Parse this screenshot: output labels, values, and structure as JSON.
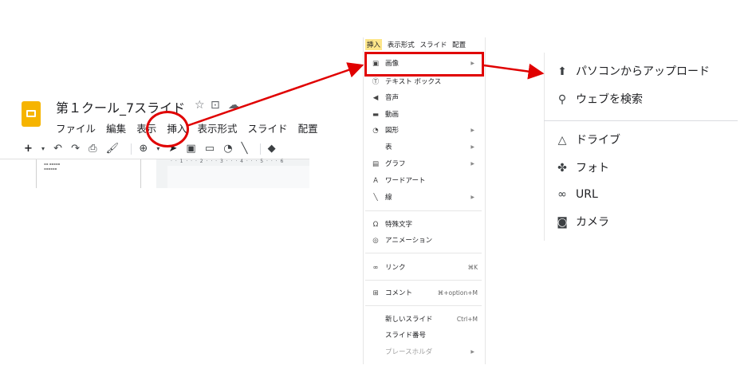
{
  "slides": {
    "doc_title": "第１クール_7スライド",
    "menu": [
      "ファイル",
      "編集",
      "表示",
      "挿入",
      "表示形式",
      "スライド",
      "配置"
    ],
    "ruler_text": "· · 1 · · · 2 · · · 3 · · · 4 · · · 5 · · · 6"
  },
  "insert_menu": {
    "header": [
      "挿入",
      "表示形式",
      "スライド",
      "配置"
    ],
    "items": [
      {
        "label": "画像",
        "icon": "image-icon",
        "arrow": true
      },
      {
        "label": "テキスト ボックス",
        "icon": "textbox-icon"
      },
      {
        "label": "音声",
        "icon": "audio-icon"
      },
      {
        "label": "動画",
        "icon": "video-icon"
      },
      {
        "label": "図形",
        "icon": "shape-icon",
        "arrow": true
      },
      {
        "label": "表",
        "icon": "",
        "arrow": true
      },
      {
        "label": "グラフ",
        "icon": "chart-icon",
        "arrow": true
      },
      {
        "label": "ワードアート",
        "icon": "wordart-icon"
      },
      {
        "label": "線",
        "icon": "line-icon",
        "arrow": true
      },
      {
        "label": "特殊文字",
        "icon": "omega-icon"
      },
      {
        "label": "アニメーション",
        "icon": "animation-icon"
      },
      {
        "label": "リンク",
        "icon": "link-icon",
        "shortcut": "⌘K"
      },
      {
        "label": "コメント",
        "icon": "comment-icon",
        "shortcut": "⌘+option+M"
      },
      {
        "label": "新しいスライド",
        "icon": "",
        "shortcut": "Ctrl+M"
      },
      {
        "label": "スライド番号",
        "icon": ""
      },
      {
        "label": "プレースホルダ",
        "icon": "",
        "arrow": true,
        "disabled": true
      }
    ]
  },
  "image_submenu": {
    "items": [
      {
        "label": "パソコンからアップロード",
        "icon": "upload-icon"
      },
      {
        "label": "ウェブを検索",
        "icon": "search-icon"
      },
      {
        "label": "ドライブ",
        "icon": "drive-icon"
      },
      {
        "label": "フォト",
        "icon": "photos-icon"
      },
      {
        "label": "URL",
        "icon": "url-link-icon"
      },
      {
        "label": "カメラ",
        "icon": "camera-icon"
      }
    ]
  },
  "colors": {
    "annotation": "#e00000",
    "highlight": "#fde68a",
    "logo": "#f6b400"
  }
}
